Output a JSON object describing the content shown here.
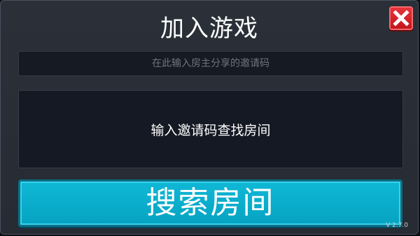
{
  "dialog": {
    "title": "加入游戏",
    "close_icon": "close-x-icon",
    "accent_close": "#d41f26",
    "accent_primary": "#06a8c7"
  },
  "invite_input": {
    "value": "",
    "placeholder": "在此输入房主分享的邀请码"
  },
  "message_panel": {
    "text": "输入邀请码查找房间"
  },
  "search_button": {
    "label": "搜索房间"
  },
  "footer": {
    "version": "V 2.7.0"
  }
}
